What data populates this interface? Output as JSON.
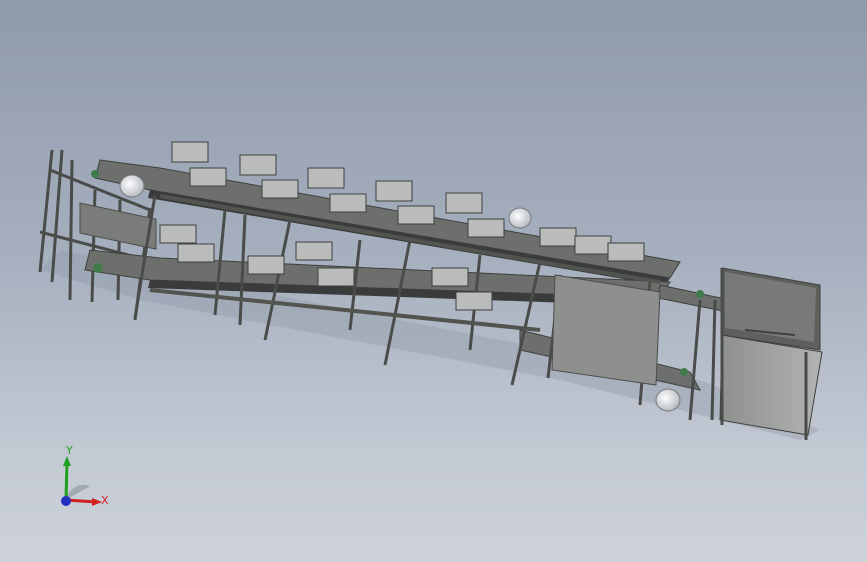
{
  "viewport": {
    "background_top": "#8f9aab",
    "background_bottom": "#cdd2da"
  },
  "model": {
    "frame_color": "#5b5d5a",
    "belt_color": "#3a3c3b",
    "module_color": "#b9bcba",
    "cabinet_color": "#9a9c99",
    "roller_color": "#e8eaec"
  },
  "triad": {
    "x_label": "X",
    "y_label": "Y",
    "x_color": "#d02020",
    "y_color": "#20a020",
    "z_color": "#2030c0"
  }
}
